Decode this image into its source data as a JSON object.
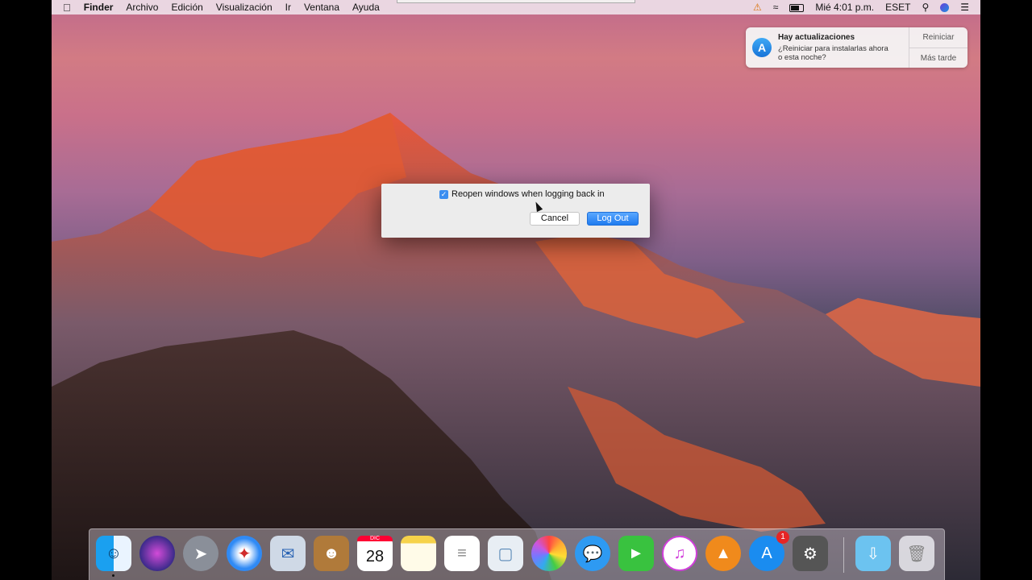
{
  "menubar": {
    "apple": "",
    "app_name": "Finder",
    "items": [
      "Archivo",
      "Edición",
      "Visualización",
      "Ir",
      "Ventana",
      "Ayuda"
    ],
    "clock": "Mié 4:01 p.m.",
    "eset": "ESET",
    "status_icons": [
      "warning-icon",
      "wifi-icon",
      "battery-icon",
      "search-icon",
      "siri-icon",
      "notification-center-icon"
    ]
  },
  "notification": {
    "title": "Hay actualizaciones",
    "body": "¿Reiniciar para instalarlas ahora o esta noche?",
    "action_primary": "Reiniciar",
    "action_secondary": "Más tarde",
    "icon": "app-store-icon"
  },
  "dialog": {
    "checkbox_label": "Reopen windows when logging back in",
    "checkbox_checked": true,
    "cancel_label": "Cancel",
    "logout_label": "Log Out"
  },
  "dock": {
    "calendar_month": "DIC",
    "calendar_day": "28",
    "app_store_badge": "1",
    "items": [
      "finder-icon",
      "siri-icon",
      "launchpad-icon",
      "safari-icon",
      "mail-icon",
      "contacts-icon",
      "calendar-icon",
      "notes-icon",
      "reminders-icon",
      "preview-icon",
      "photos-icon",
      "messages-icon",
      "facetime-icon",
      "itunes-icon",
      "ibooks-icon",
      "app-store-icon",
      "system-preferences-icon",
      "downloads-icon",
      "trash-icon"
    ]
  }
}
